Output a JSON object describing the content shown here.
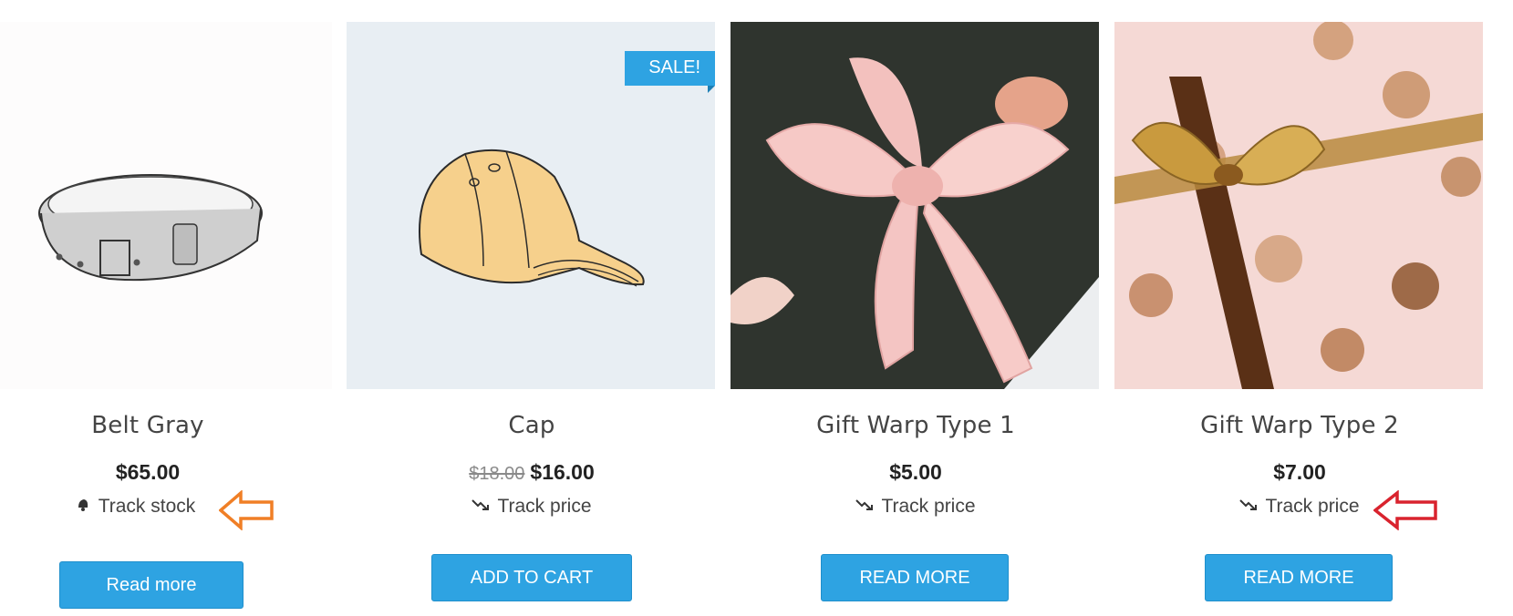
{
  "products": [
    {
      "title": "Belt Gray",
      "price": "$65.00",
      "track_label": "Track stock",
      "button_label": "Read more"
    },
    {
      "title": "Cap",
      "old_price": "$18.00",
      "price": "$16.00",
      "badge": "SALE!",
      "track_label": "Track price",
      "button_label": "ADD TO CART"
    },
    {
      "title": "Gift Warp Type 1",
      "price": "$5.00",
      "track_label": "Track price",
      "button_label": "READ MORE"
    },
    {
      "title": "Gift Warp Type 2",
      "price": "$7.00",
      "track_label": "Track price",
      "button_label": "READ MORE"
    }
  ],
  "colors": {
    "accent": "#2ea3e2",
    "arrow_orange": "#f07f26",
    "arrow_red": "#d9232e"
  },
  "icons": {
    "track_stock": "bell-icon",
    "track_price": "trend-down-icon",
    "annotation": "arrow-left-outline-icon"
  }
}
